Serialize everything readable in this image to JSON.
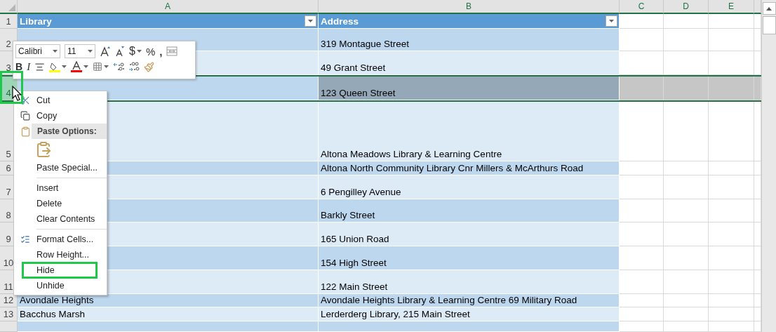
{
  "column_headers": [
    "A",
    "B",
    "C",
    "D",
    "E"
  ],
  "table": {
    "header": {
      "number": "1",
      "columns": [
        "Library",
        "Address"
      ]
    },
    "rows": [
      {
        "number": "2",
        "address": "319 Montague Street",
        "selected": false,
        "marked": false
      },
      {
        "number": "3",
        "address": "49 Grant Street",
        "selected": false,
        "marked": false
      },
      {
        "number": "4",
        "address": "123 Queen Street",
        "selected": true,
        "marked": true
      },
      {
        "number": "5",
        "address": "Altona Meadows Library & Learning Centre",
        "selected": false,
        "marked": false
      },
      {
        "number": "6",
        "address": "Altona North Community Library Cnr Millers & McArthurs Road",
        "selected": false,
        "marked": false
      },
      {
        "number": "7",
        "address": "6 Pengilley Avenue",
        "selected": false,
        "marked": false
      },
      {
        "number": "8",
        "address": "Barkly Street",
        "selected": false,
        "marked": false
      },
      {
        "number": "9",
        "address": "165 Union Road",
        "selected": false,
        "marked": false
      },
      {
        "number": "10",
        "address": "154 High Street",
        "selected": false,
        "marked": false
      },
      {
        "number": "11",
        "address": "122 Main Street",
        "selected": false,
        "marked": false
      },
      {
        "number": "12",
        "library": "Avondale Heights",
        "address": "Avondale Heights Library & Learning Centre 69 Military Road",
        "selected": false,
        "marked": false
      },
      {
        "number": "13",
        "library": "Bacchus Marsh",
        "address": "Lerderderg Library, 215 Main Street",
        "selected": false,
        "marked": false
      },
      {
        "selected": false,
        "marked": false
      }
    ]
  },
  "mini_toolbar": {
    "font": "Calibri",
    "size": "11",
    "bold": "B",
    "italic": "I",
    "currency": "$",
    "percent": "%",
    "comma": ","
  },
  "context_menu": [
    {
      "kind": "cut",
      "label": "Cut",
      "marked": false
    },
    {
      "kind": "copy",
      "label": "Copy",
      "marked": false
    },
    {
      "kind": "header",
      "label": "Paste Options:"
    },
    {
      "kind": "paste-option"
    },
    {
      "kind": "item",
      "label": "Paste Special...",
      "marked": false
    },
    {
      "kind": "separator"
    },
    {
      "kind": "item",
      "label": "Insert",
      "marked": false
    },
    {
      "kind": "item",
      "label": "Delete",
      "marked": false
    },
    {
      "kind": "item",
      "label": "Clear Contents",
      "marked": false
    },
    {
      "kind": "separator"
    },
    {
      "kind": "format",
      "label": "Format Cells...",
      "marked": false
    },
    {
      "kind": "item",
      "label": "Row Height...",
      "marked": false
    },
    {
      "kind": "item",
      "label": "Hide",
      "marked": true
    },
    {
      "kind": "item",
      "label": "Unhide",
      "marked": false
    }
  ]
}
